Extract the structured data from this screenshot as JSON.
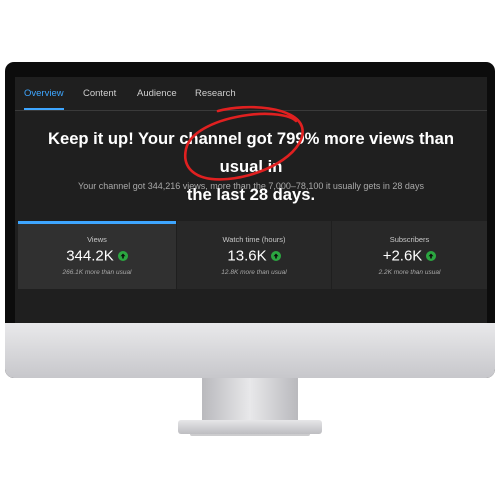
{
  "tabs": [
    {
      "label": "Overview",
      "active": true
    },
    {
      "label": "Content"
    },
    {
      "label": "Audience"
    },
    {
      "label": "Research"
    }
  ],
  "headline": {
    "line1": "Keep it up! Your channel got 799% more views than usual in",
    "line2": "the last 28 days."
  },
  "subline": "Your channel got 344,216 views, more than the 7,000–78,100 it usually gets in 28 days",
  "metrics": [
    {
      "label": "Views",
      "value": "344.2K",
      "sub": "266.1K more than usual",
      "trend_icon": "arrow-up-circle-icon"
    },
    {
      "label": "Watch time (hours)",
      "value": "13.6K",
      "sub": "12.8K more than usual",
      "trend_icon": "arrow-up-circle-icon"
    },
    {
      "label": "Subscribers",
      "value": "+2.6K",
      "sub": "2.2K more than usual",
      "trend_icon": "arrow-up-circle-icon"
    }
  ],
  "colors": {
    "accent": "#3ea6ff",
    "up": "#2ba640",
    "annotation": "#e02020",
    "screen_bg": "#1f1f1f"
  }
}
